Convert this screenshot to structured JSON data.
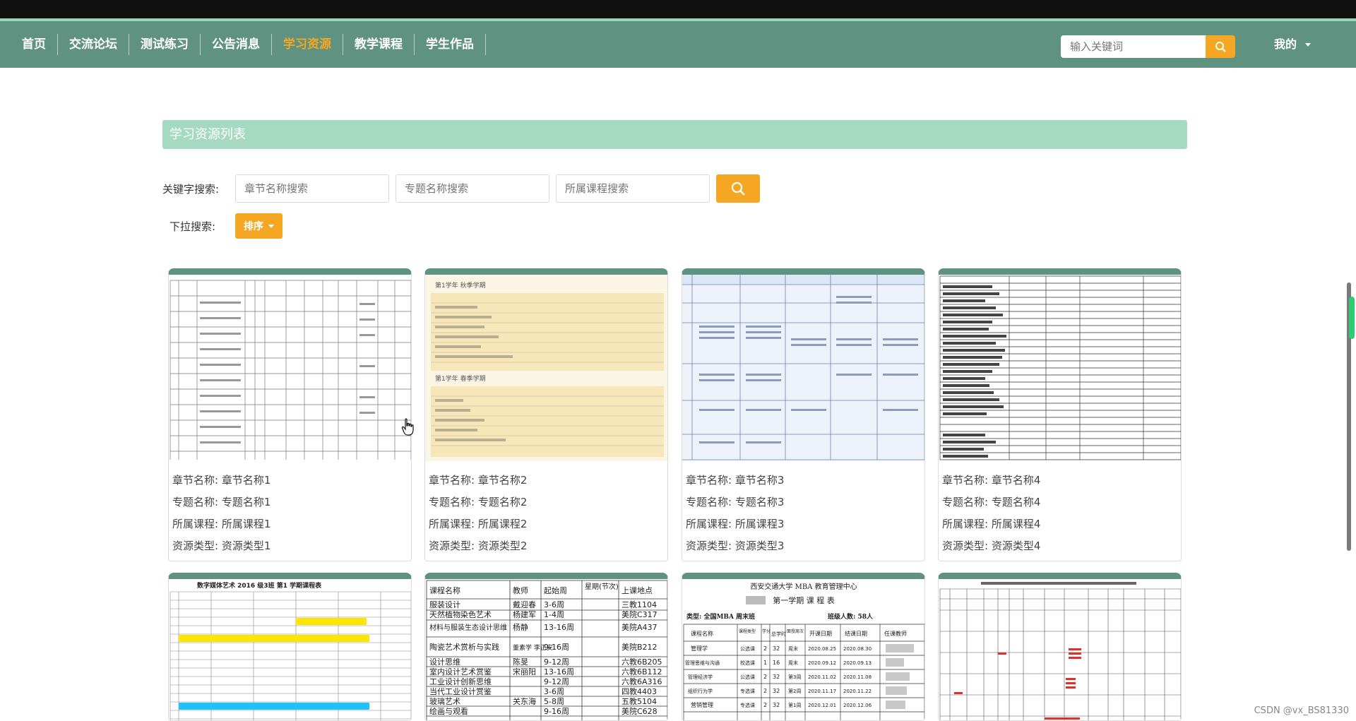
{
  "nav": {
    "items": [
      "首页",
      "交流论坛",
      "测试练习",
      "公告消息",
      "学习资源",
      "教学课程",
      "学生作品"
    ],
    "active": "学习资源",
    "search_placeholder": "输入关键词",
    "search_icon": "search-icon",
    "user_label": "我的"
  },
  "page": {
    "section_title": "学习资源列表"
  },
  "search": {
    "keyword_label": "关键字搜索:",
    "chapter_placeholder": "章节名称搜索",
    "topic_placeholder": "专题名称搜索",
    "course_placeholder": "所属课程搜索",
    "dropdown_label": "下拉搜索:",
    "sort_label": "排序"
  },
  "cards": [
    {
      "chapter_label": "章节名称:",
      "chapter": "章节名称1",
      "topic_label": "专题名称:",
      "topic": "专题名称1",
      "course_label": "所属课程:",
      "course": "所属课程1",
      "type_label": "资源类型:",
      "type": "资源类型1"
    },
    {
      "chapter_label": "章节名称:",
      "chapter": "章节名称2",
      "topic_label": "专题名称:",
      "topic": "专题名称2",
      "course_label": "所属课程:",
      "course": "所属课程2",
      "type_label": "资源类型:",
      "type": "资源类型2"
    },
    {
      "chapter_label": "章节名称:",
      "chapter": "章节名称3",
      "topic_label": "专题名称:",
      "topic": "专题名称3",
      "course_label": "所属课程:",
      "course": "所属课程3",
      "type_label": "资源类型:",
      "type": "资源类型3"
    },
    {
      "chapter_label": "章节名称:",
      "chapter": "章节名称4",
      "topic_label": "专题名称:",
      "topic": "专题名称4",
      "course_label": "所属课程:",
      "course": "所属课程4",
      "type_label": "资源类型:",
      "type": "资源类型4"
    }
  ],
  "thumb_text": {
    "t6_headers": [
      "课程名称",
      "教师",
      "起始周",
      "星期(节次)",
      "上课地点"
    ],
    "t6_rows": [
      [
        "服装设计",
        "戴迎春",
        "3-6周",
        "",
        "三教1104"
      ],
      [
        "天然植物染色艺术",
        "杨建军",
        "1-4周",
        "",
        "美院C317"
      ],
      [
        "材料与服装生态设计思维",
        "杨静",
        "13-16周",
        "",
        "美院A437"
      ],
      [
        "陶瓷艺术赏析与实践",
        "董素学 李正安",
        "9-16周",
        "",
        "美院B212"
      ],
      [
        "设计思维",
        "陈旻",
        "9-12周",
        "",
        "六教6B205"
      ],
      [
        "室内设计艺术赏鉴",
        "宋丽阳",
        "13-16周",
        "",
        "六教6B112"
      ],
      [
        "工业设计创新思维",
        "",
        "9-12周",
        "",
        "六教6A316"
      ],
      [
        "当代工业设计赏鉴",
        "",
        "3-6周",
        "",
        "四教4403"
      ],
      [
        "玻璃艺术",
        "关东海",
        "5-8周",
        "",
        "五教5104"
      ],
      [
        "绘画与观看",
        "",
        "9-16周",
        "",
        "美院C628"
      ]
    ],
    "t7_university": "西安交通大学  MBA 教育管理中心",
    "t7_title": "第一学期 课 程 表",
    "t7_type": "类型: 全国MBA  周末班",
    "t7_class_count": "班级人数: 58人",
    "t7_headers": [
      "课程名称",
      "课程类型",
      "学分",
      "总学时",
      "面授周次",
      "开课日期",
      "结课日期",
      "任课教师"
    ],
    "t7_rows": [
      [
        "管理学",
        "公选课",
        "2",
        "32",
        "周末",
        "2020.08.25",
        "2020.08.30",
        ""
      ],
      [
        "管理思维与沟通",
        "校选课",
        "1",
        "16",
        "周末",
        "2020.09.12",
        "2020.09.13",
        ""
      ],
      [
        "管理经济学",
        "公选课",
        "2",
        "32",
        "第3周",
        "2020.11.02",
        "2020.11.08",
        ""
      ],
      [
        "组织行为学",
        "专选课",
        "2",
        "32",
        "第2周",
        "2020.11.17",
        "2020.11.22",
        ""
      ],
      [
        "营销管理",
        "专选课",
        "2",
        "32",
        "第1周",
        "2020.12.01",
        "2020.12.06",
        ""
      ]
    ],
    "t5_title": "数字媒体艺术 2016 级3班  第1 学期课程表",
    "t2_title": "第1学年 秋季学期",
    "t2_title_b": "第1学年 春季学期"
  },
  "watermark": "CSDN @vx_BS81330",
  "colors": {
    "nav_bg": "#5f9281",
    "accent": "#f5a623",
    "title_bar": "#a5d9c2"
  }
}
